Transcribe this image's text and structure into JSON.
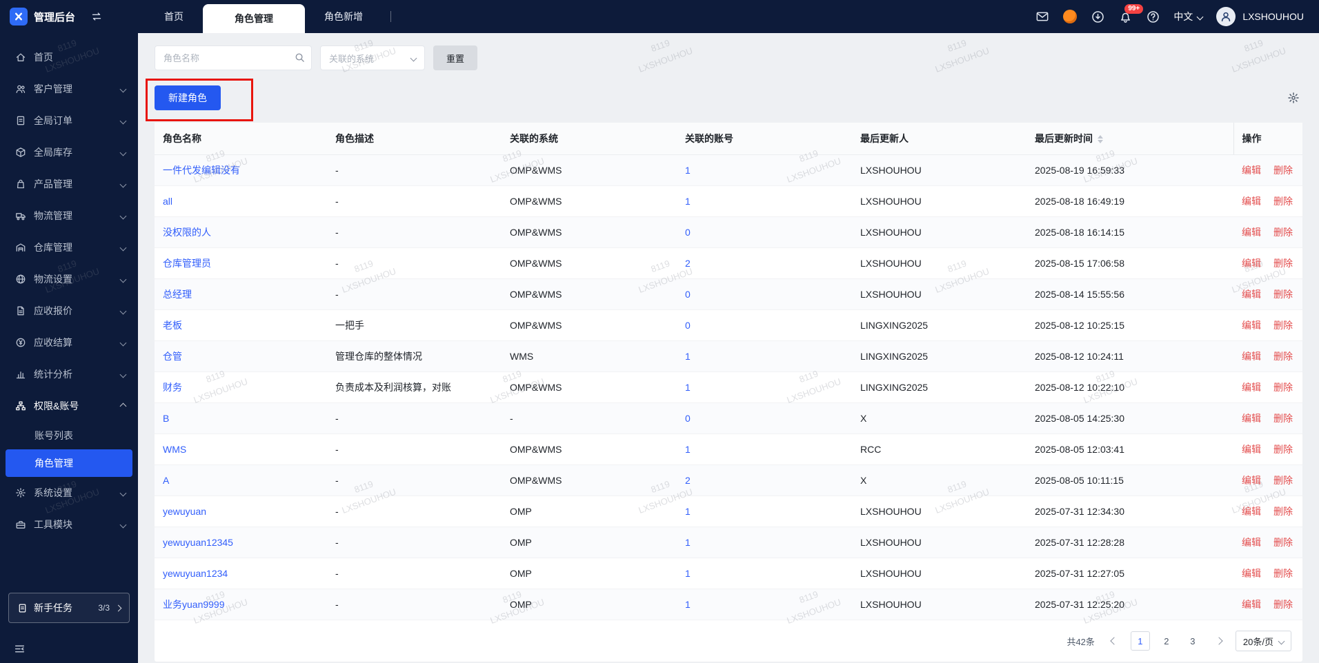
{
  "app": {
    "title": "管理后台"
  },
  "topbar": {
    "tabs": [
      {
        "label": "首页"
      },
      {
        "label": "角色管理"
      },
      {
        "label": "角色新增"
      }
    ],
    "badge": "99+",
    "lang": "中文",
    "user": "LXSHOUHOU"
  },
  "sidebar": {
    "items": [
      {
        "label": "首页"
      },
      {
        "label": "客户管理"
      },
      {
        "label": "全局订单"
      },
      {
        "label": "全局库存"
      },
      {
        "label": "产品管理"
      },
      {
        "label": "物流管理"
      },
      {
        "label": "仓库管理"
      },
      {
        "label": "物流设置"
      },
      {
        "label": "应收报价"
      },
      {
        "label": "应收结算"
      },
      {
        "label": "统计分析"
      },
      {
        "label": "权限&账号"
      },
      {
        "label": "系统设置"
      },
      {
        "label": "工具模块"
      }
    ],
    "sub": [
      {
        "label": "账号列表"
      },
      {
        "label": "角色管理"
      }
    ],
    "task": {
      "label": "新手任务",
      "progress": "3/3"
    }
  },
  "filters": {
    "name_placeholder": "角色名称",
    "system_placeholder": "关联的系统",
    "reset_label": "重置"
  },
  "toolbar": {
    "create_label": "新建角色"
  },
  "table": {
    "columns": [
      "角色名称",
      "角色描述",
      "关联的系统",
      "关联的账号",
      "最后更新人",
      "最后更新时间",
      "操作"
    ],
    "edit_label": "编辑",
    "delete_label": "删除",
    "rows": [
      {
        "name": "一件代发编辑没有",
        "desc": "-",
        "system": "OMP&WMS",
        "accounts": "1",
        "updater": "LXSHOUHOU",
        "time": "2025-08-19 16:59:33"
      },
      {
        "name": "all",
        "desc": "-",
        "system": "OMP&WMS",
        "accounts": "1",
        "updater": "LXSHOUHOU",
        "time": "2025-08-18 16:49:19"
      },
      {
        "name": "没权限的人",
        "desc": "-",
        "system": "OMP&WMS",
        "accounts": "0",
        "updater": "LXSHOUHOU",
        "time": "2025-08-18 16:14:15"
      },
      {
        "name": "仓库管理员",
        "desc": "-",
        "system": "OMP&WMS",
        "accounts": "2",
        "updater": "LXSHOUHOU",
        "time": "2025-08-15 17:06:58"
      },
      {
        "name": "总经理",
        "desc": "-",
        "system": "OMP&WMS",
        "accounts": "0",
        "updater": "LXSHOUHOU",
        "time": "2025-08-14 15:55:56"
      },
      {
        "name": "老板",
        "desc": "一把手",
        "system": "OMP&WMS",
        "accounts": "0",
        "updater": "LINGXING2025",
        "time": "2025-08-12 10:25:15"
      },
      {
        "name": "仓管",
        "desc": "管理仓库的整体情况",
        "system": "WMS",
        "accounts": "1",
        "updater": "LINGXING2025",
        "time": "2025-08-12 10:24:11"
      },
      {
        "name": "财务",
        "desc": "负责成本及利润核算，对账",
        "system": "OMP&WMS",
        "accounts": "1",
        "updater": "LINGXING2025",
        "time": "2025-08-12 10:22:10"
      },
      {
        "name": "B",
        "desc": "-",
        "system": "-",
        "accounts": "0",
        "updater": "X",
        "time": "2025-08-05 14:25:30"
      },
      {
        "name": "WMS",
        "desc": "-",
        "system": "OMP&WMS",
        "accounts": "1",
        "updater": "RCC",
        "time": "2025-08-05 12:03:41"
      },
      {
        "name": "A",
        "desc": "-",
        "system": "OMP&WMS",
        "accounts": "2",
        "updater": "X",
        "time": "2025-08-05 10:11:15"
      },
      {
        "name": "yewuyuan",
        "desc": "-",
        "system": "OMP",
        "accounts": "1",
        "updater": "LXSHOUHOU",
        "time": "2025-07-31 12:34:30"
      },
      {
        "name": "yewuyuan12345",
        "desc": "-",
        "system": "OMP",
        "accounts": "1",
        "updater": "LXSHOUHOU",
        "time": "2025-07-31 12:28:28"
      },
      {
        "name": "yewuyuan1234",
        "desc": "-",
        "system": "OMP",
        "accounts": "1",
        "updater": "LXSHOUHOU",
        "time": "2025-07-31 12:27:05"
      },
      {
        "name": "业务yuan9999",
        "desc": "-",
        "system": "OMP",
        "accounts": "1",
        "updater": "LXSHOUHOU",
        "time": "2025-07-31 12:25:20"
      }
    ]
  },
  "pagination": {
    "total": "共42条",
    "pages": [
      "1",
      "2",
      "3"
    ],
    "active_page": "1",
    "page_size": "20条/页"
  },
  "watermark": {
    "line1": "8119",
    "line2": "LXSHOUHOU"
  },
  "colors": {
    "topbar_bg": "#0d1b3a",
    "accent": "#2458f0",
    "link": "#315efb",
    "action_red": "#e34d4d",
    "annotation_red": "#e8150c",
    "badge_red": "#f54242",
    "promo_orange": "#ff8a1e",
    "page_bg": "#eef0f3"
  }
}
